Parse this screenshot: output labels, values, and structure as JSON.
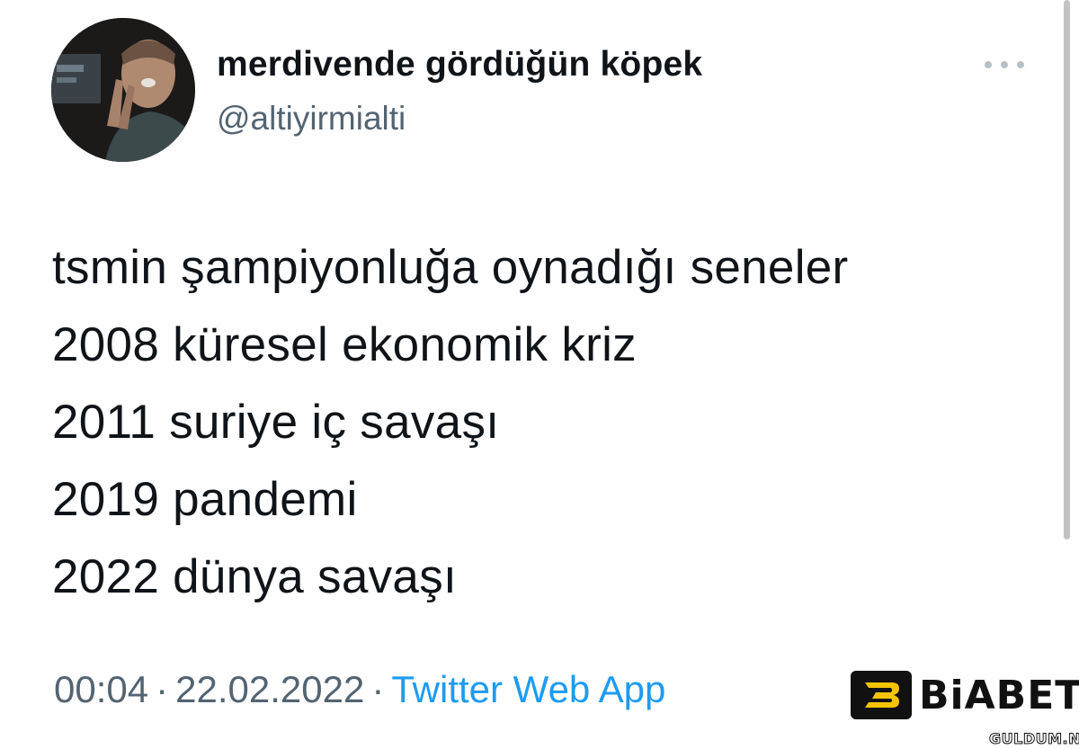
{
  "author": {
    "display_name": "merdivende gördüğün köpek",
    "handle": "@altiyirmialti",
    "avatar": "avatar-photo"
  },
  "actions": {
    "more_icon": "more-horizontal-icon"
  },
  "tweet": {
    "lines": [
      "tsmin şampiyonluğa oynadığı seneler",
      "2008 küresel ekonomik kriz",
      "2011 suriye iç savaşı",
      "2019 pandemi",
      "2022 dünya savaşı"
    ]
  },
  "meta": {
    "time": "00:04",
    "separator": "·",
    "date": "22.02.2022",
    "source": "Twitter Web App"
  },
  "branding": {
    "logo_text": "BiABET",
    "watermark": "GULDUM.NET"
  },
  "colors": {
    "text_primary": "#0f1419",
    "text_secondary": "#536471",
    "link": "#1d9bf0"
  }
}
